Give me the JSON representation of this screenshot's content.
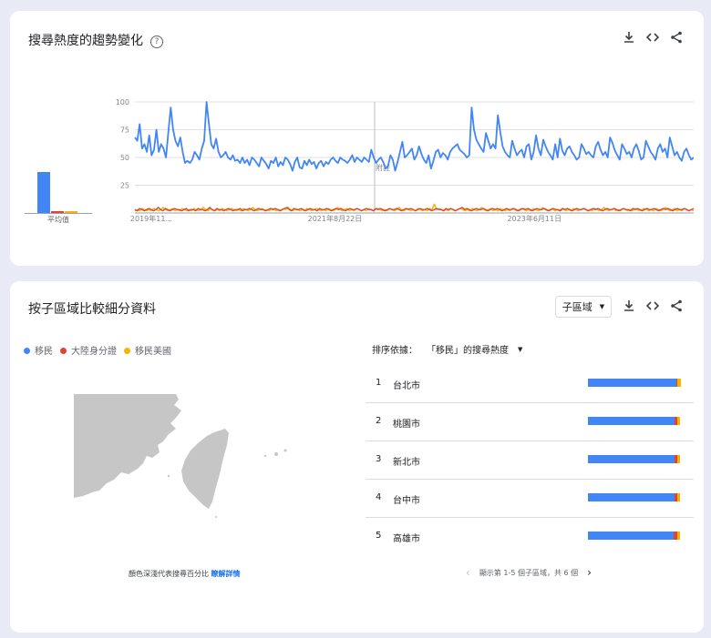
{
  "trend_card": {
    "title": "搜尋熱度的趨勢變化",
    "help_glyph": "?",
    "avg_label": "平均值",
    "avg_values": [
      55,
      3,
      3
    ],
    "y_ticks": [
      "100",
      "75",
      "50",
      "25"
    ],
    "x_ticks": [
      "2019年11...",
      "2021年8月22日",
      "2023年6月11日"
    ],
    "note_label": "附註"
  },
  "region_card": {
    "title": "按子區域比較細分資料",
    "region_button": "子區域",
    "sort_prefix": "排序依據：",
    "sort_value": "「移民」的搜尋熱度",
    "legend": [
      {
        "name": "移民",
        "color": "#4285f4"
      },
      {
        "name": "大陸身分證",
        "color": "#db4437"
      },
      {
        "name": "移民美國",
        "color": "#f4b400"
      }
    ],
    "rows": [
      {
        "rank": "1",
        "name": "台北市",
        "values": [
          96,
          1,
          4
        ]
      },
      {
        "rank": "2",
        "name": "桃園市",
        "values": [
          94,
          3,
          3
        ]
      },
      {
        "rank": "3",
        "name": "新北市",
        "values": [
          94,
          3,
          3
        ]
      },
      {
        "rank": "4",
        "name": "台中市",
        "values": [
          94,
          3,
          3
        ]
      },
      {
        "rank": "5",
        "name": "高雄市",
        "values": [
          93,
          4,
          3
        ]
      }
    ],
    "map_caption": "顏色深淺代表搜尋百分比",
    "map_caption_link": "瞭解詳情",
    "pager_text": "顯示第 1-5 個子區域，共 6 個"
  },
  "colors": {
    "blue": "#4285f4",
    "red": "#db4437",
    "yellow": "#f4b400"
  },
  "chart_data": {
    "type": "line",
    "ylim": [
      0,
      100
    ],
    "x_ticks": [
      "2019年11...",
      "2021年8月22日",
      "2023年6月11日"
    ],
    "series": [
      {
        "name": "移民",
        "values": [
          68,
          65,
          80,
          58,
          62,
          55,
          70,
          52,
          57,
          75,
          55,
          62,
          58,
          50,
          73,
          95,
          75,
          65,
          60,
          68,
          55,
          45,
          47,
          45,
          48,
          55,
          52,
          48,
          58,
          65,
          100,
          80,
          62,
          58,
          67,
          55,
          50,
          52,
          55,
          50,
          48,
          52,
          47,
          48,
          45,
          50,
          45,
          48,
          43,
          50,
          48,
          45,
          42,
          50,
          47,
          44,
          40,
          47,
          45,
          50,
          42,
          46,
          43,
          50,
          48,
          44,
          38,
          46,
          50,
          41,
          40,
          47,
          43,
          48,
          44,
          46,
          40,
          45,
          47,
          42,
          46,
          44,
          48,
          50,
          47,
          45,
          50,
          48,
          47,
          45,
          48,
          52,
          46,
          50,
          48,
          46,
          50,
          48,
          46,
          57,
          50,
          45,
          48,
          50,
          46,
          40,
          42,
          52,
          48,
          38,
          46,
          55,
          64,
          50,
          52,
          55,
          58,
          48,
          52,
          60,
          53,
          48,
          45,
          52,
          40,
          47,
          55,
          57,
          50,
          54,
          52,
          48,
          55,
          58,
          60,
          62,
          57,
          55,
          53,
          50,
          52,
          95,
          75,
          66,
          62,
          58,
          55,
          72,
          65,
          58,
          62,
          58,
          88,
          73,
          60,
          55,
          52,
          50,
          65,
          58,
          52,
          55,
          57,
          50,
          60,
          62,
          48,
          55,
          70,
          58,
          52,
          66,
          60,
          55,
          52,
          48,
          62,
          50,
          67,
          56,
          52,
          58,
          60,
          55,
          52,
          48,
          50,
          62,
          58,
          53,
          55,
          52,
          50,
          60,
          64,
          57,
          52,
          55,
          50,
          68,
          63,
          56,
          52,
          48,
          62,
          58,
          53,
          55,
          50,
          58,
          62,
          56,
          48,
          50,
          65,
          60,
          55,
          52,
          48,
          58,
          62,
          55,
          58,
          50,
          68,
          60,
          52,
          55,
          50,
          47,
          55,
          58,
          52,
          48,
          50
        ]
      },
      {
        "name": "大陸身分證",
        "values": [
          3,
          2,
          4,
          3,
          2,
          3,
          4,
          3,
          2,
          3,
          5,
          3,
          2,
          4,
          3,
          2,
          3,
          4,
          3,
          3,
          2,
          3,
          4,
          2,
          3,
          3,
          2,
          4,
          3,
          3,
          2,
          3,
          5,
          3,
          2,
          4,
          3,
          3,
          2,
          3,
          4,
          3,
          2,
          3,
          3,
          4,
          2,
          3,
          3,
          4,
          3,
          2,
          3,
          4,
          3,
          3,
          2,
          3,
          4,
          3,
          4,
          3,
          2,
          3,
          4,
          5,
          3,
          2,
          4,
          3,
          3,
          4,
          3,
          2,
          3,
          4,
          3,
          3,
          2,
          4,
          3,
          3,
          4,
          3,
          2,
          3,
          4,
          3,
          4,
          3,
          2,
          3,
          4,
          3,
          3,
          4,
          3,
          2,
          3,
          4,
          3,
          3,
          2,
          4,
          3,
          4,
          3,
          2,
          3,
          4,
          3,
          3,
          4,
          3,
          2,
          3,
          4,
          3,
          4,
          3,
          2,
          3,
          4,
          3,
          3,
          4,
          3,
          2,
          3,
          4,
          3,
          3,
          2,
          4,
          3,
          4,
          3,
          2,
          3,
          4,
          5,
          3,
          4,
          3,
          2,
          3,
          4,
          3,
          3,
          4,
          3,
          2,
          3,
          4,
          3,
          4,
          3,
          2,
          3,
          4,
          3,
          3,
          4,
          3,
          2,
          3,
          4,
          3,
          4,
          3,
          2,
          3,
          4,
          3,
          3,
          4,
          3,
          2,
          3,
          4,
          3,
          3,
          2,
          4,
          3,
          4,
          3,
          2,
          3,
          4,
          3,
          3,
          4,
          3,
          2,
          3,
          4,
          3,
          4,
          3,
          2,
          3,
          4,
          3,
          3,
          4,
          3,
          2,
          3,
          4,
          3,
          3,
          2,
          4,
          3,
          4,
          3,
          2,
          3,
          4,
          3,
          3,
          4,
          3,
          2,
          3,
          4,
          3,
          4,
          3,
          2,
          3,
          4,
          3,
          3,
          4,
          3,
          2,
          3,
          4
        ]
      },
      {
        "name": "移民美國",
        "values": [
          2,
          3,
          2,
          4,
          3,
          2,
          3,
          2,
          4,
          3,
          2,
          3,
          5,
          3,
          2,
          3,
          4,
          2,
          3,
          2,
          4,
          3,
          2,
          3,
          2,
          4,
          3,
          2,
          3,
          5,
          3,
          2,
          4,
          3,
          2,
          3,
          2,
          4,
          3,
          2,
          3,
          4,
          3,
          2,
          3,
          2,
          4,
          3,
          2,
          3,
          5,
          3,
          2,
          3,
          4,
          2,
          3,
          2,
          4,
          3,
          2,
          3,
          2,
          4,
          3,
          5,
          3,
          2,
          4,
          3,
          2,
          3,
          2,
          4,
          3,
          2,
          3,
          4,
          3,
          2,
          3,
          2,
          4,
          3,
          2,
          3,
          5,
          3,
          2,
          3,
          4,
          2,
          3,
          2,
          4,
          3,
          2,
          3,
          2,
          4,
          3,
          2,
          3,
          4,
          3,
          2,
          3,
          2,
          4,
          3,
          2,
          3,
          5,
          3,
          2,
          3,
          4,
          2,
          3,
          2,
          4,
          3,
          2,
          3,
          2,
          4,
          3,
          8,
          3,
          4,
          3,
          2,
          3,
          2,
          4,
          3,
          2,
          3,
          4,
          3,
          2,
          3,
          2,
          4,
          3,
          2,
          3,
          5,
          3,
          2,
          3,
          4,
          2,
          3,
          2,
          4,
          3,
          2,
          3,
          2,
          4,
          3,
          2,
          3,
          4,
          3,
          2,
          3,
          2,
          4,
          3,
          2,
          3,
          5,
          3,
          2,
          3,
          4,
          2,
          3,
          2,
          4,
          3,
          2,
          3,
          2,
          4,
          3,
          2,
          3,
          4,
          3,
          2,
          3,
          2,
          4,
          3,
          2,
          3,
          5,
          3,
          2,
          3,
          4,
          2,
          3,
          2,
          4,
          3,
          2,
          3,
          2,
          4,
          3,
          2,
          3,
          4,
          3,
          2,
          3,
          2,
          4,
          3,
          2,
          3,
          5,
          3,
          2,
          3,
          4,
          2,
          3,
          2,
          4,
          3,
          2,
          3,
          2
        ]
      }
    ]
  }
}
